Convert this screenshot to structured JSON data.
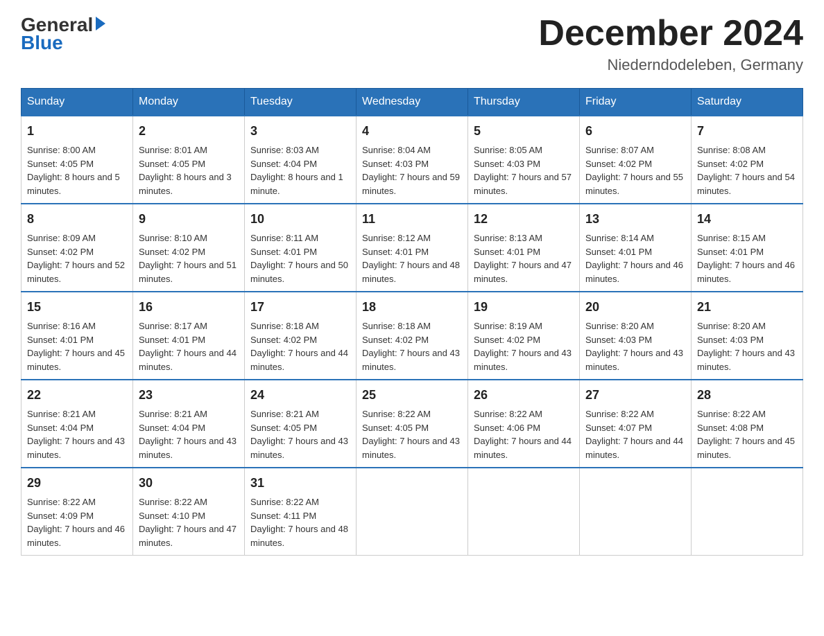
{
  "logo": {
    "text_general": "General",
    "text_blue": "Blue"
  },
  "header": {
    "month_title": "December 2024",
    "location": "Niederndodeleben, Germany"
  },
  "days_of_week": [
    "Sunday",
    "Monday",
    "Tuesday",
    "Wednesday",
    "Thursday",
    "Friday",
    "Saturday"
  ],
  "weeks": [
    [
      {
        "day": "1",
        "sunrise": "8:00 AM",
        "sunset": "4:05 PM",
        "daylight": "8 hours and 5 minutes."
      },
      {
        "day": "2",
        "sunrise": "8:01 AM",
        "sunset": "4:05 PM",
        "daylight": "8 hours and 3 minutes."
      },
      {
        "day": "3",
        "sunrise": "8:03 AM",
        "sunset": "4:04 PM",
        "daylight": "8 hours and 1 minute."
      },
      {
        "day": "4",
        "sunrise": "8:04 AM",
        "sunset": "4:03 PM",
        "daylight": "7 hours and 59 minutes."
      },
      {
        "day": "5",
        "sunrise": "8:05 AM",
        "sunset": "4:03 PM",
        "daylight": "7 hours and 57 minutes."
      },
      {
        "day": "6",
        "sunrise": "8:07 AM",
        "sunset": "4:02 PM",
        "daylight": "7 hours and 55 minutes."
      },
      {
        "day": "7",
        "sunrise": "8:08 AM",
        "sunset": "4:02 PM",
        "daylight": "7 hours and 54 minutes."
      }
    ],
    [
      {
        "day": "8",
        "sunrise": "8:09 AM",
        "sunset": "4:02 PM",
        "daylight": "7 hours and 52 minutes."
      },
      {
        "day": "9",
        "sunrise": "8:10 AM",
        "sunset": "4:02 PM",
        "daylight": "7 hours and 51 minutes."
      },
      {
        "day": "10",
        "sunrise": "8:11 AM",
        "sunset": "4:01 PM",
        "daylight": "7 hours and 50 minutes."
      },
      {
        "day": "11",
        "sunrise": "8:12 AM",
        "sunset": "4:01 PM",
        "daylight": "7 hours and 48 minutes."
      },
      {
        "day": "12",
        "sunrise": "8:13 AM",
        "sunset": "4:01 PM",
        "daylight": "7 hours and 47 minutes."
      },
      {
        "day": "13",
        "sunrise": "8:14 AM",
        "sunset": "4:01 PM",
        "daylight": "7 hours and 46 minutes."
      },
      {
        "day": "14",
        "sunrise": "8:15 AM",
        "sunset": "4:01 PM",
        "daylight": "7 hours and 46 minutes."
      }
    ],
    [
      {
        "day": "15",
        "sunrise": "8:16 AM",
        "sunset": "4:01 PM",
        "daylight": "7 hours and 45 minutes."
      },
      {
        "day": "16",
        "sunrise": "8:17 AM",
        "sunset": "4:01 PM",
        "daylight": "7 hours and 44 minutes."
      },
      {
        "day": "17",
        "sunrise": "8:18 AM",
        "sunset": "4:02 PM",
        "daylight": "7 hours and 44 minutes."
      },
      {
        "day": "18",
        "sunrise": "8:18 AM",
        "sunset": "4:02 PM",
        "daylight": "7 hours and 43 minutes."
      },
      {
        "day": "19",
        "sunrise": "8:19 AM",
        "sunset": "4:02 PM",
        "daylight": "7 hours and 43 minutes."
      },
      {
        "day": "20",
        "sunrise": "8:20 AM",
        "sunset": "4:03 PM",
        "daylight": "7 hours and 43 minutes."
      },
      {
        "day": "21",
        "sunrise": "8:20 AM",
        "sunset": "4:03 PM",
        "daylight": "7 hours and 43 minutes."
      }
    ],
    [
      {
        "day": "22",
        "sunrise": "8:21 AM",
        "sunset": "4:04 PM",
        "daylight": "7 hours and 43 minutes."
      },
      {
        "day": "23",
        "sunrise": "8:21 AM",
        "sunset": "4:04 PM",
        "daylight": "7 hours and 43 minutes."
      },
      {
        "day": "24",
        "sunrise": "8:21 AM",
        "sunset": "4:05 PM",
        "daylight": "7 hours and 43 minutes."
      },
      {
        "day": "25",
        "sunrise": "8:22 AM",
        "sunset": "4:05 PM",
        "daylight": "7 hours and 43 minutes."
      },
      {
        "day": "26",
        "sunrise": "8:22 AM",
        "sunset": "4:06 PM",
        "daylight": "7 hours and 44 minutes."
      },
      {
        "day": "27",
        "sunrise": "8:22 AM",
        "sunset": "4:07 PM",
        "daylight": "7 hours and 44 minutes."
      },
      {
        "day": "28",
        "sunrise": "8:22 AM",
        "sunset": "4:08 PM",
        "daylight": "7 hours and 45 minutes."
      }
    ],
    [
      {
        "day": "29",
        "sunrise": "8:22 AM",
        "sunset": "4:09 PM",
        "daylight": "7 hours and 46 minutes."
      },
      {
        "day": "30",
        "sunrise": "8:22 AM",
        "sunset": "4:10 PM",
        "daylight": "7 hours and 47 minutes."
      },
      {
        "day": "31",
        "sunrise": "8:22 AM",
        "sunset": "4:11 PM",
        "daylight": "7 hours and 48 minutes."
      },
      null,
      null,
      null,
      null
    ]
  ],
  "labels": {
    "sunrise_prefix": "Sunrise: ",
    "sunset_prefix": "Sunset: ",
    "daylight_prefix": "Daylight: "
  }
}
